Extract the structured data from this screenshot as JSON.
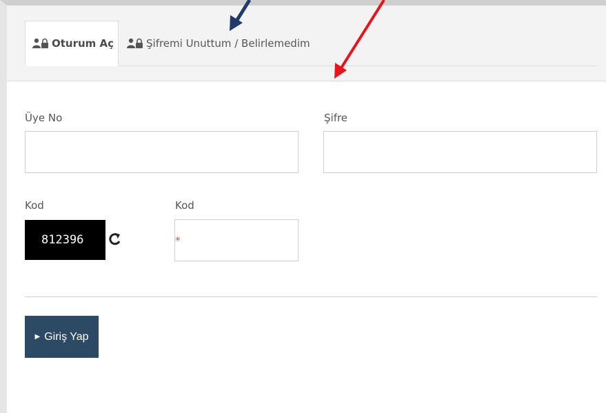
{
  "tabs": [
    {
      "label": "Oturum Aç",
      "icon": "users-lock-icon",
      "active": true
    },
    {
      "label": "Şifremi Unuttum / Belirlemedim",
      "icon": "users-lock-icon",
      "active": false
    }
  ],
  "form": {
    "member_no_label": "Üye No",
    "member_no_value": "",
    "password_label": "Şifre",
    "password_value": "",
    "code_label": "Kod",
    "code_input_label": "Kod",
    "captcha_text": "812396",
    "code_input_value": "",
    "required_mark": "*"
  },
  "actions": {
    "submit_label": "Giriş Yap"
  },
  "colors": {
    "button_bg": "#2c4a63",
    "arrow_blue": "#1f3a6b",
    "arrow_red": "#e8141b",
    "required": "#d9534f"
  }
}
